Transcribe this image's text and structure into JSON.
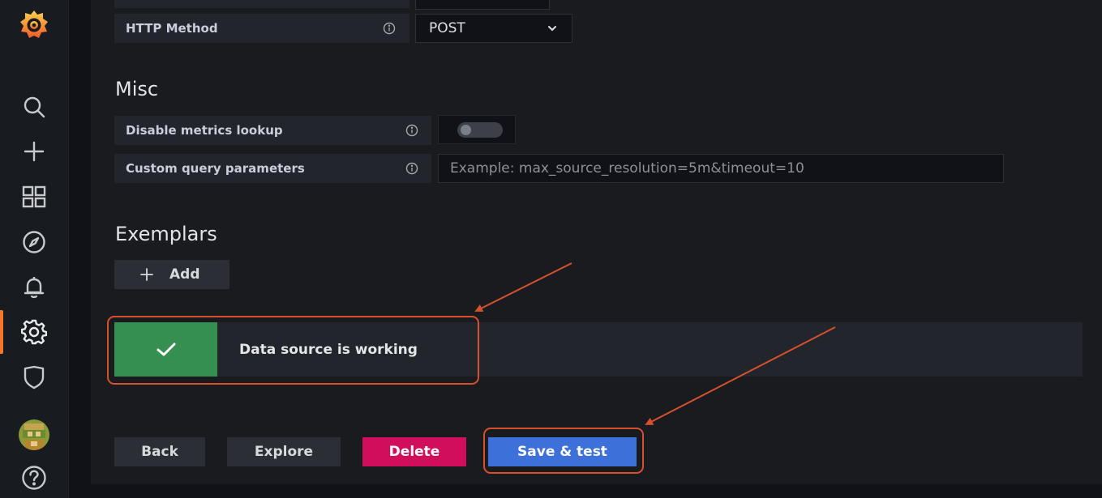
{
  "sidebar": {
    "items": [
      {
        "name": "grafana-logo-icon"
      },
      {
        "name": "search-icon"
      },
      {
        "name": "create-plus-icon"
      },
      {
        "name": "dashboards-grid-icon"
      },
      {
        "name": "explore-compass-icon"
      },
      {
        "name": "alerting-bell-icon"
      },
      {
        "name": "configuration-gear-icon",
        "active": true
      },
      {
        "name": "server-admin-shield-icon"
      },
      {
        "name": "user-avatar"
      },
      {
        "name": "help-icon"
      }
    ]
  },
  "http": {
    "label": "HTTP Method",
    "value": "POST"
  },
  "misc": {
    "heading": "Misc",
    "disable_metrics_label": "Disable metrics lookup",
    "disable_metrics_enabled": false,
    "custom_params_label": "Custom query parameters",
    "custom_params_placeholder": "Example: max_source_resolution=5m&timeout=10",
    "custom_params_value": ""
  },
  "exemplars": {
    "heading": "Exemplars",
    "add_label": "Add"
  },
  "alert": {
    "message": "Data source is working",
    "status": "success"
  },
  "actions": {
    "back": "Back",
    "explore": "Explore",
    "delete": "Delete",
    "save_test": "Save & test"
  },
  "colors": {
    "accent_orange": "#f5762b",
    "success_green": "#348f50",
    "delete_red": "#d10e5c",
    "primary_blue": "#3d71d9",
    "annotation_red": "#d6502e"
  }
}
